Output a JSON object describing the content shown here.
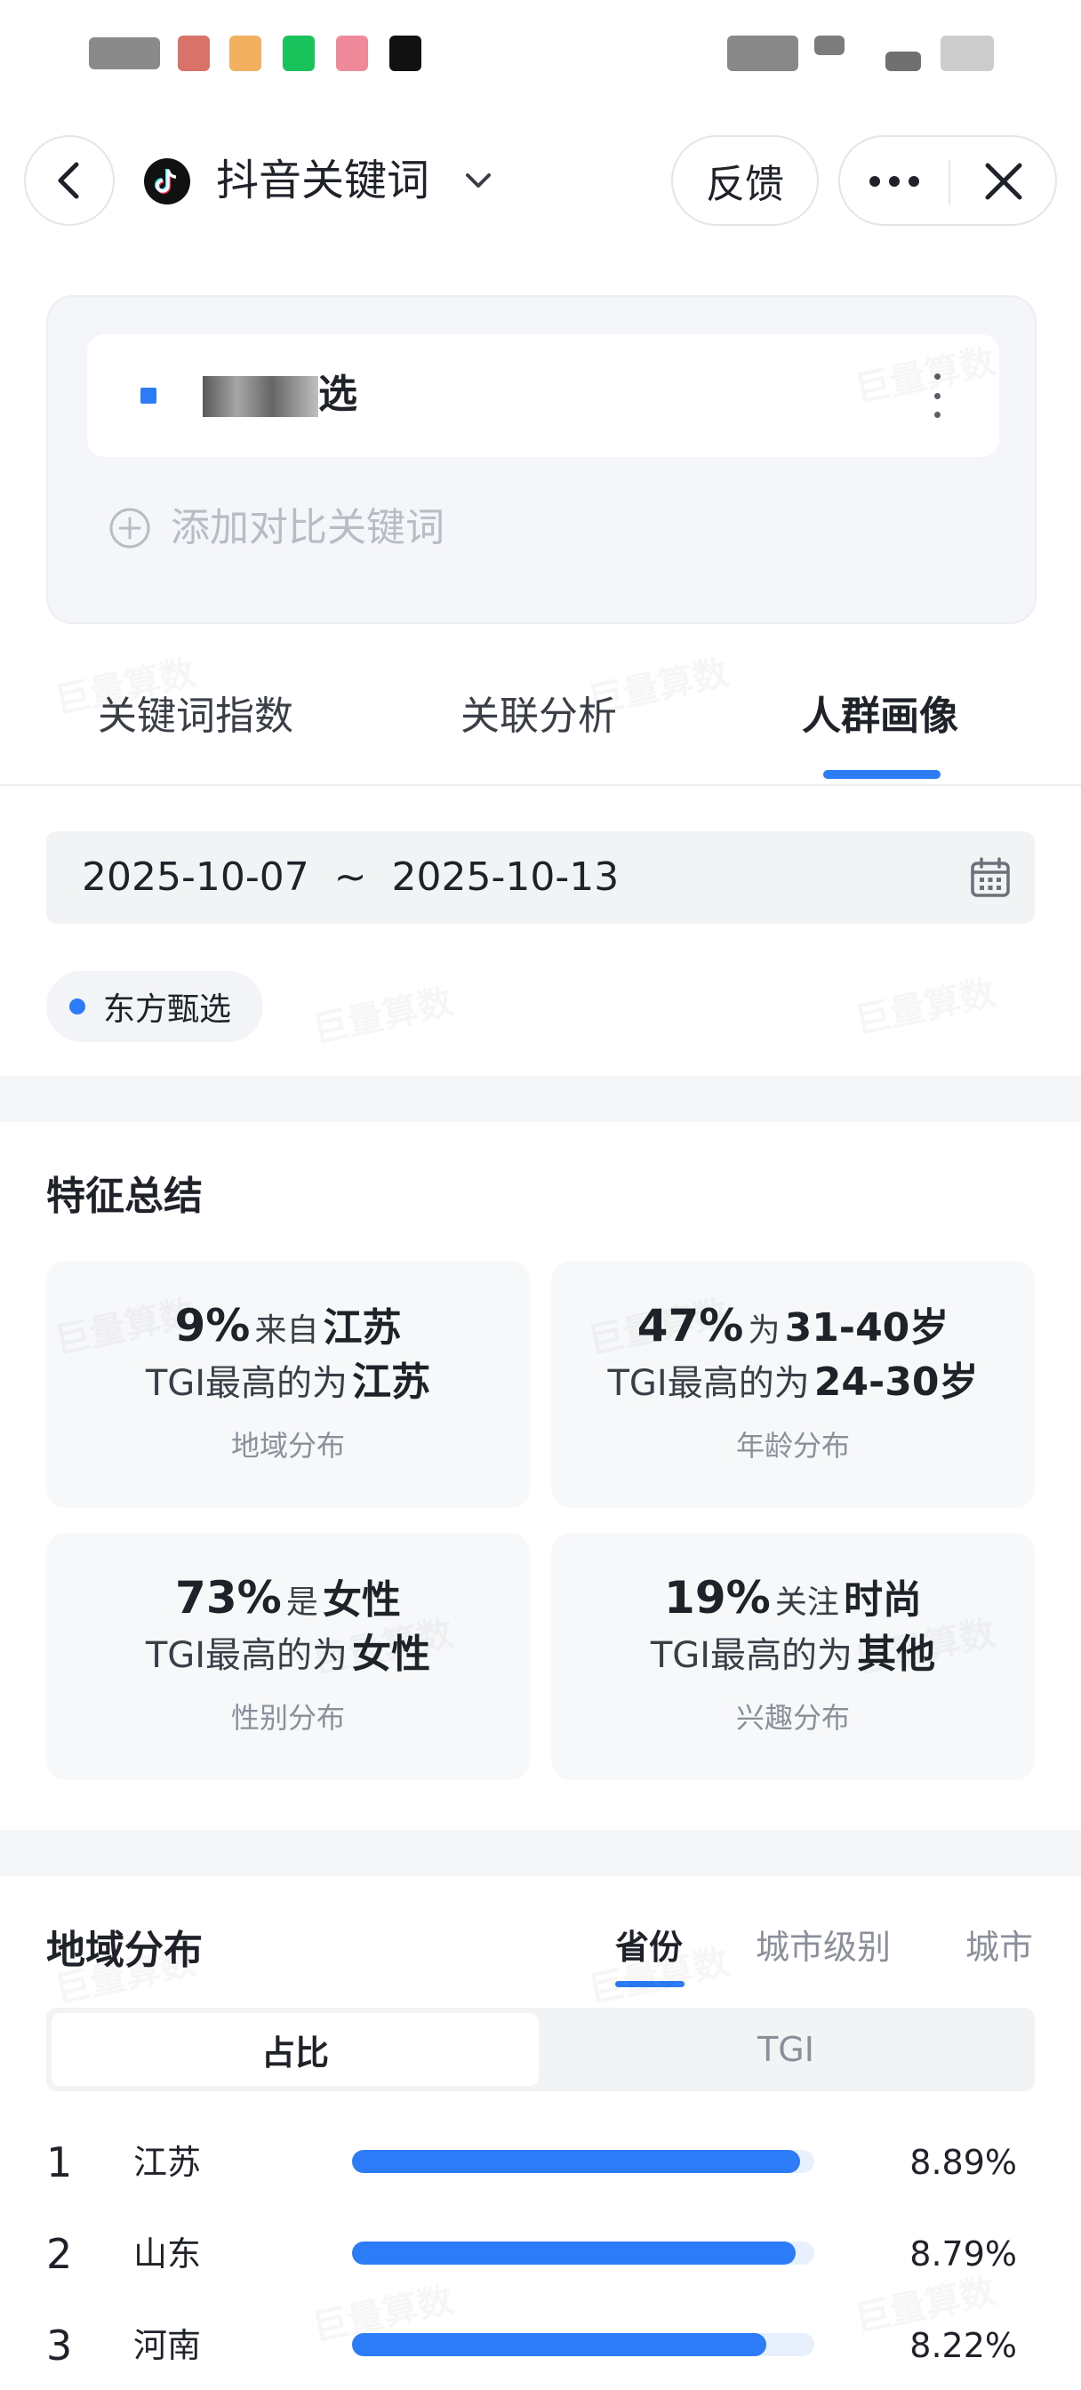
{
  "nav": {
    "title": "抖音关键词",
    "feedback_label": "反馈"
  },
  "keyword_card": {
    "keyword": "选",
    "add_compare_label": "添加对比关键词"
  },
  "tabs": [
    {
      "label": "关键词指数",
      "active": false
    },
    {
      "label": "关联分析",
      "active": false
    },
    {
      "label": "人群画像",
      "active": true
    }
  ],
  "date_range": {
    "text": "2025-10-07  ~  2025-10-13"
  },
  "chip": {
    "label": "东方甄选",
    "color": "#2b7cf6"
  },
  "summary": {
    "title": "特征总结",
    "cards": [
      {
        "value": "9%",
        "mid": "来自",
        "target": "江苏",
        "tgi_prefix": "TGI最高的为",
        "tgi_value": "江苏",
        "caption": "地域分布"
      },
      {
        "value": "47%",
        "mid": "为",
        "target": "31-40岁",
        "tgi_prefix": "TGI最高的为",
        "tgi_value": "24-30岁",
        "caption": "年龄分布"
      },
      {
        "value": "73%",
        "mid": "是",
        "target": "女性",
        "tgi_prefix": "TGI最高的为",
        "tgi_value": "女性",
        "caption": "性别分布"
      },
      {
        "value": "19%",
        "mid": "关注",
        "target": "时尚",
        "tgi_prefix": "TGI最高的为",
        "tgi_value": "其他",
        "caption": "兴趣分布"
      }
    ]
  },
  "region": {
    "title": "地域分布",
    "tabs": [
      {
        "label": "省份",
        "active": true
      },
      {
        "label": "城市级别",
        "active": false
      },
      {
        "label": "城市",
        "active": false
      }
    ],
    "segments": [
      {
        "label": "占比",
        "active": true
      },
      {
        "label": "TGI",
        "active": false
      }
    ],
    "rows": [
      {
        "rank": "1",
        "name": "江苏",
        "value_label": "8.89%",
        "value": 8.89
      },
      {
        "rank": "2",
        "name": "山东",
        "value_label": "8.79%",
        "value": 8.79
      },
      {
        "rank": "3",
        "name": "河南",
        "value_label": "8.22%",
        "value": 8.22
      }
    ],
    "bar_color": "#2b7cf6"
  },
  "watermark": "巨量算数"
}
